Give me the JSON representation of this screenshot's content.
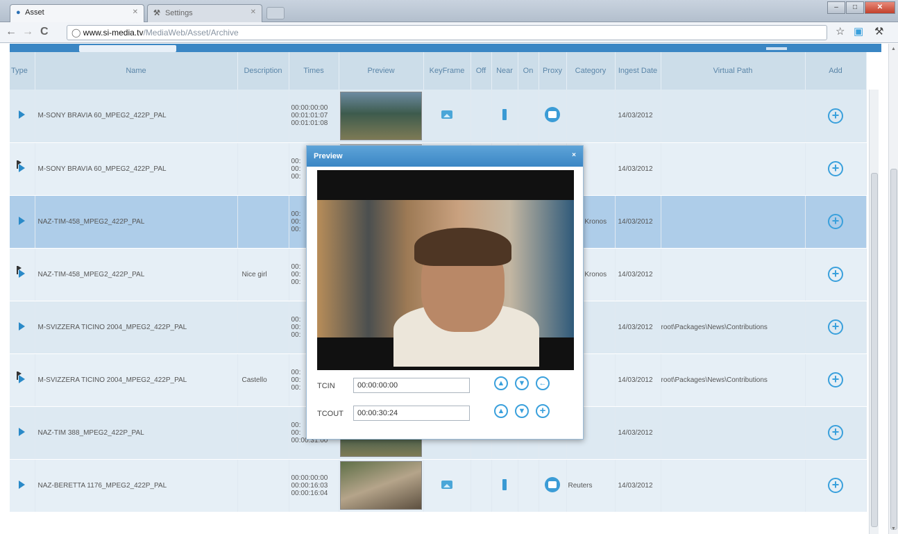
{
  "browser": {
    "tabs": [
      {
        "label": "Asset",
        "active": true
      },
      {
        "label": "Settings",
        "active": false
      }
    ],
    "url_host": "www.si-media.tv",
    "url_path": "/MediaWeb/Asset/Archive",
    "icons": {
      "back": "back-arrow-icon",
      "forward": "forward-arrow-icon",
      "reload": "reload-icon",
      "star": "star-icon",
      "wrench": "wrench-icon"
    }
  },
  "table": {
    "columns": [
      "Type",
      "Name",
      "Description",
      "Times",
      "Preview",
      "KeyFrame",
      "Off",
      "Near",
      "On",
      "Proxy",
      "Category",
      "Ingest Date",
      "Virtual Path",
      "Add"
    ],
    "rows": [
      {
        "flag": false,
        "name": "M-SONY BRAVIA 60_MPEG2_422P_PAL",
        "description": "",
        "times": [
          "00:00:00:00",
          "00:01:01:07",
          "00:01:01:08"
        ],
        "category": "",
        "ingest_date": "14/03/2012",
        "virtual_path": "",
        "style": "row",
        "keyframe": true,
        "near": true,
        "proxy": true
      },
      {
        "flag": true,
        "name": "M-SONY BRAVIA 60_MPEG2_422P_PAL",
        "description": "",
        "times": [
          "00:",
          "00:",
          "00:"
        ],
        "category": "",
        "ingest_date": "14/03/2012",
        "virtual_path": "",
        "style": "alt",
        "keyframe": false,
        "near": false,
        "proxy": false
      },
      {
        "flag": false,
        "name": "NAZ-TIM-458_MPEG2_422P_PAL",
        "description": "",
        "times": [
          "00:",
          "00:",
          "00:"
        ],
        "category": "ADN Kronos",
        "ingest_date": "14/03/2012",
        "virtual_path": "",
        "style": "sel",
        "keyframe": false,
        "near": false,
        "proxy": false
      },
      {
        "flag": true,
        "name": "NAZ-TIM-458_MPEG2_422P_PAL",
        "description": "Nice girl",
        "times": [
          "00:",
          "00:",
          "00:"
        ],
        "category": "ADN Kronos",
        "ingest_date": "14/03/2012",
        "virtual_path": "",
        "style": "alt",
        "keyframe": false,
        "near": false,
        "proxy": false
      },
      {
        "flag": false,
        "name": "M-SVIZZERA TICINO 2004_MPEG2_422P_PAL",
        "description": "",
        "times": [
          "00:",
          "00:",
          "00:"
        ],
        "category": "",
        "ingest_date": "14/03/2012",
        "virtual_path": "root\\Packages\\News\\Contributions",
        "style": "row",
        "keyframe": false,
        "near": false,
        "proxy": false
      },
      {
        "flag": true,
        "name": "M-SVIZZERA TICINO 2004_MPEG2_422P_PAL",
        "description": "Castello",
        "times": [
          "00:",
          "00:",
          "00:"
        ],
        "category": "",
        "ingest_date": "14/03/2012",
        "virtual_path": "root\\Packages\\News\\Contributions",
        "style": "alt",
        "keyframe": false,
        "near": false,
        "proxy": false
      },
      {
        "flag": false,
        "name": "NAZ-TIM 388_MPEG2_422P_PAL",
        "description": "",
        "times": [
          "00:",
          "00:",
          "00:00:31:00"
        ],
        "category": "",
        "ingest_date": "14/03/2012",
        "virtual_path": "",
        "style": "row",
        "keyframe": false,
        "near": false,
        "proxy": false
      },
      {
        "flag": false,
        "name": "NAZ-BERETTA 1176_MPEG2_422P_PAL",
        "description": "",
        "times": [
          "00:00:00:00",
          "00:00:16:03",
          "00:00:16:04"
        ],
        "category": "Reuters",
        "ingest_date": "14/03/2012",
        "virtual_path": "",
        "style": "alt",
        "keyframe": true,
        "near": true,
        "proxy": true
      }
    ]
  },
  "preview": {
    "title": "Preview",
    "close": "×",
    "tcin_label": "TCIN",
    "tcin_value": "00:00:00:00",
    "tcout_label": "TCOUT",
    "tcout_value": "00:00:30:24",
    "buttons": {
      "up": "▲",
      "down": "▼",
      "left": "←",
      "add": "+"
    }
  },
  "colors": {
    "header_bg": "#3a86c4",
    "row_selected": "#aecde9",
    "accent": "#3aa0dc"
  }
}
